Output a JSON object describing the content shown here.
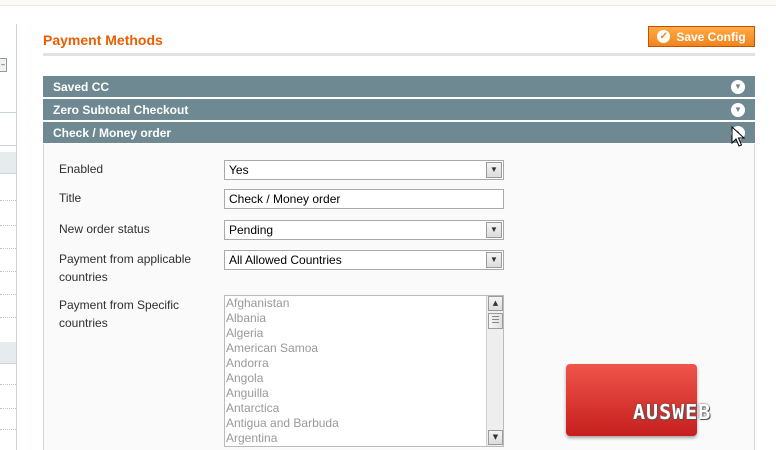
{
  "page": {
    "title": "Payment Methods",
    "save_button": "Save Config"
  },
  "sections": [
    {
      "label": "Saved CC",
      "state": "collapsed"
    },
    {
      "label": "Zero Subtotal Checkout",
      "state": "collapsed"
    },
    {
      "label": "Check / Money order",
      "state": "expanded"
    }
  ],
  "form": {
    "enabled": {
      "label": "Enabled",
      "value": "Yes"
    },
    "title": {
      "label": "Title",
      "value": "Check / Money order"
    },
    "order_status": {
      "label": "New order status",
      "value": "Pending"
    },
    "allowspecific": {
      "label_line1": "Payment from applicable",
      "label_line2": "countries",
      "value": "All Allowed Countries"
    },
    "specificcountry": {
      "label_line1": "Payment from Specific",
      "label_line2": "countries",
      "options": [
        "Afghanistan",
        "Albania",
        "Algeria",
        "American Samoa",
        "Andorra",
        "Angola",
        "Anguilla",
        "Antarctica",
        "Antigua and Barbuda",
        "Argentina"
      ]
    }
  },
  "watermark": {
    "text": "AUSWEB"
  },
  "colors": {
    "accent": "#eb5e00",
    "section_header": "#6f8992",
    "button": "#f0841c",
    "watermark": "#d9302c"
  },
  "icons": {
    "save": "check-icon",
    "section_toggle": "chevron-down-circle-icon",
    "cursor": "pointer-cursor-icon"
  }
}
